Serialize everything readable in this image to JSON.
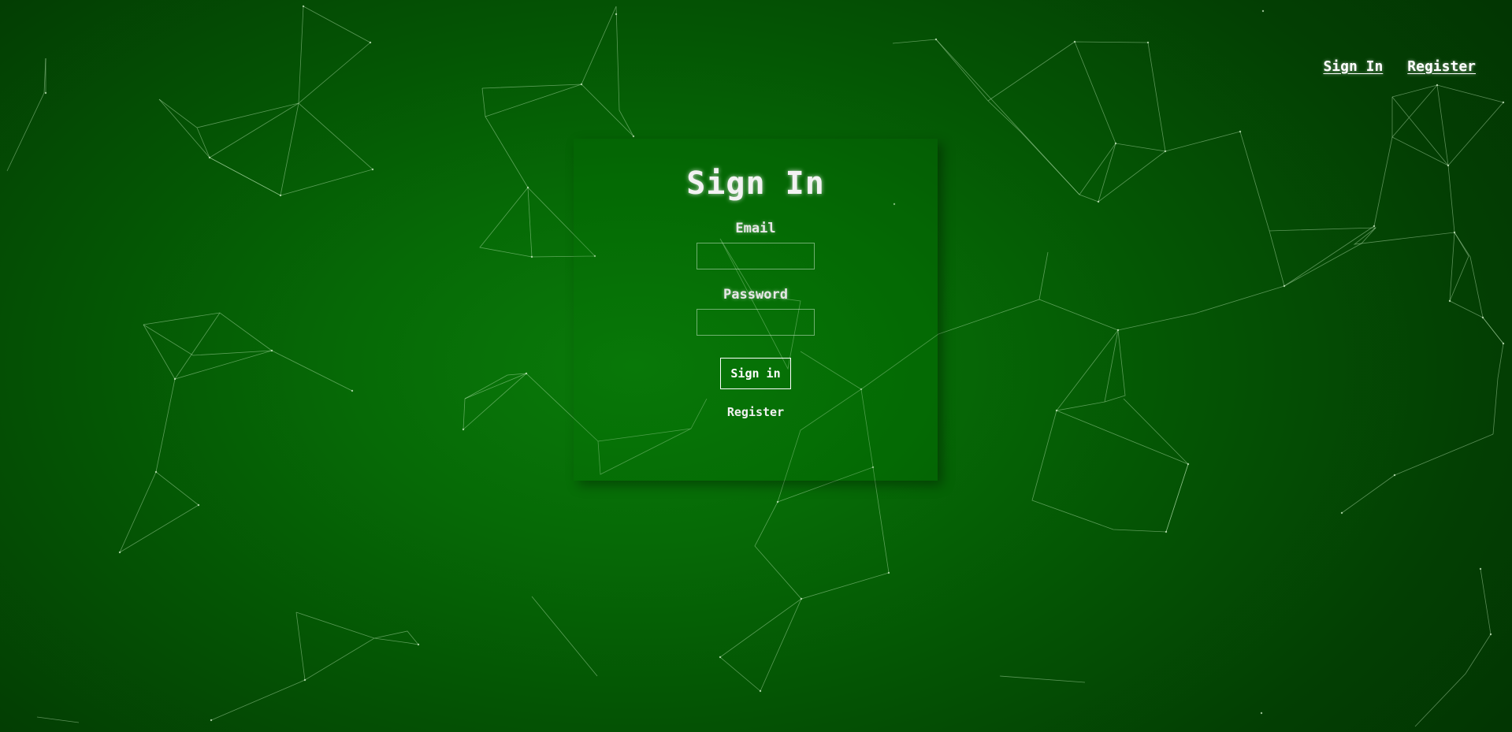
{
  "nav": {
    "sign_in_label": "Sign In",
    "register_label": "Register"
  },
  "login": {
    "title": "Sign In",
    "email_label": "Email",
    "email_value": "",
    "password_label": "Password",
    "password_value": "",
    "submit_label": "Sign in",
    "register_label": "Register"
  },
  "theme": {
    "background": "#066a06",
    "line_color": "#b8e6b0",
    "text_color": "#ffffff"
  }
}
